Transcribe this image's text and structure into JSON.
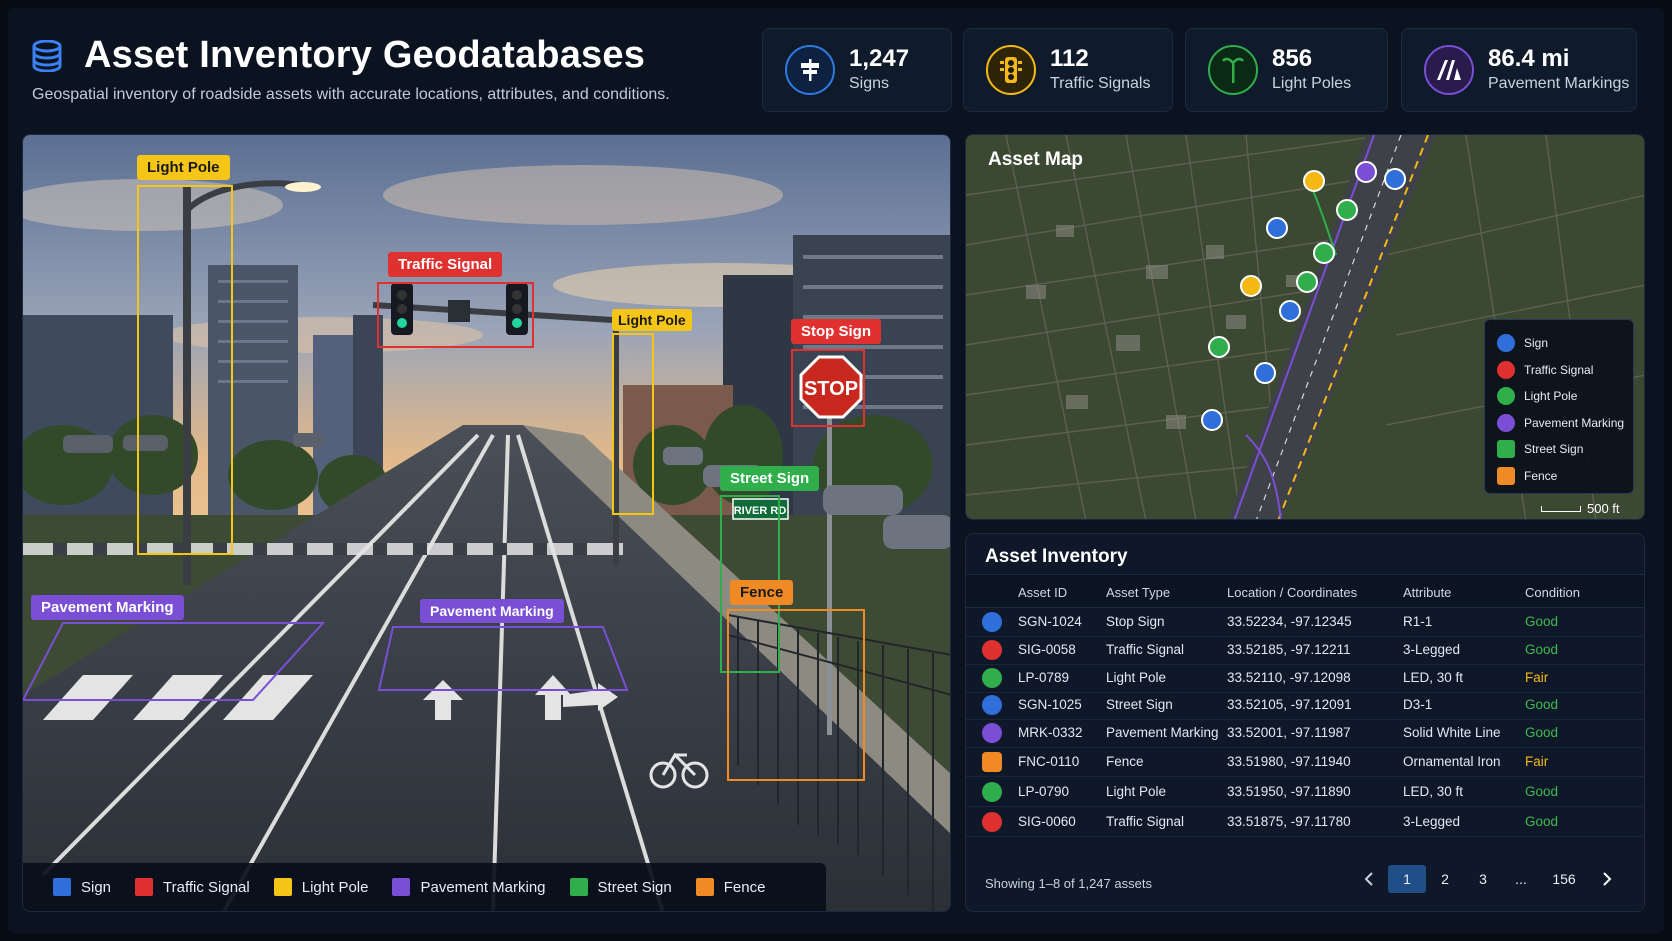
{
  "header": {
    "title": "Asset Inventory Geodatabases",
    "subtitle": "Geospatial inventory of roadside assets with accurate locations, attributes, and conditions."
  },
  "stats": [
    {
      "value": "1,247",
      "label": "Signs",
      "icon": "sign-icon",
      "color": "#2f7ae5"
    },
    {
      "value": "112",
      "label": "Traffic Signals",
      "icon": "traffic-light-icon",
      "color": "#f5b915"
    },
    {
      "value": "856",
      "label": "Light Poles",
      "icon": "light-pole-icon",
      "color": "#2fae4b"
    },
    {
      "value": "86.4 mi",
      "label": "Pavement Markings",
      "icon": "pavement-marking-icon",
      "color": "#7a4fd6"
    }
  ],
  "photo": {
    "tags": {
      "light_pole_1": "Light Pole",
      "traffic_signal": "Traffic Signal",
      "light_pole_2": "Light Pole",
      "stop_sign": "Stop Sign",
      "street_sign": "Street Sign",
      "fence": "Fence",
      "pavement_marking_1": "Pavement Marking",
      "pavement_marking_2": "Pavement Marking"
    },
    "stop_text": "STOP",
    "street_sign_text": "RIVER RD",
    "legend": [
      {
        "label": "Sign",
        "color": "#2f6fdc"
      },
      {
        "label": "Traffic Signal",
        "color": "#e03131"
      },
      {
        "label": "Light Pole",
        "color": "#f5c518"
      },
      {
        "label": "Pavement Marking",
        "color": "#7a4fd6"
      },
      {
        "label": "Street Sign",
        "color": "#2fae4b"
      },
      {
        "label": "Fence",
        "color": "#f08a24"
      }
    ]
  },
  "map": {
    "title": "Asset Map",
    "legend": [
      {
        "label": "Sign",
        "color": "#2f6fdc",
        "icon": "sign-icon"
      },
      {
        "label": "Traffic Signal",
        "color": "#e03131",
        "icon": "traffic-light-icon"
      },
      {
        "label": "Light Pole",
        "color": "#2fae4b",
        "icon": "light-pole-icon"
      },
      {
        "label": "Pavement Marking",
        "color": "#7a4fd6",
        "icon": "pavement-marking-icon"
      },
      {
        "label": "Street Sign",
        "color": "#2fae4b",
        "icon": "street-sign-icon"
      },
      {
        "label": "Fence",
        "color": "#f08a24",
        "icon": "fence-icon"
      }
    ],
    "scale": "500 ft"
  },
  "inventory": {
    "title": "Asset Inventory",
    "columns": [
      "Asset ID",
      "Asset Type",
      "Location / Coordinates",
      "Attribute",
      "Condition"
    ],
    "rows": [
      {
        "id": "SGN-1024",
        "type": "Stop Sign",
        "loc": "33.52234, -97.12345",
        "attr": "R1-1",
        "cond": "Good",
        "kind": "sign"
      },
      {
        "id": "SIG-0058",
        "type": "Traffic Signal",
        "loc": "33.52185, -97.12211",
        "attr": "3-Legged",
        "cond": "Good",
        "kind": "signal"
      },
      {
        "id": "LP-0789",
        "type": "Light Pole",
        "loc": "33.52110, -97.12098",
        "attr": "LED, 30 ft",
        "cond": "Fair",
        "kind": "pole"
      },
      {
        "id": "SGN-1025",
        "type": "Street Sign",
        "loc": "33.52105, -97.12091",
        "attr": "D3-1",
        "cond": "Good",
        "kind": "sign"
      },
      {
        "id": "MRK-0332",
        "type": "Pavement Marking",
        "loc": "33.52001, -97.11987",
        "attr": "Solid White Line",
        "cond": "Good",
        "kind": "marking"
      },
      {
        "id": "FNC-0110",
        "type": "Fence",
        "loc": "33.51980, -97.11940",
        "attr": "Ornamental Iron",
        "cond": "Fair",
        "kind": "fence"
      },
      {
        "id": "LP-0790",
        "type": "Light Pole",
        "loc": "33.51950, -97.11890",
        "attr": "LED, 30 ft",
        "cond": "Good",
        "kind": "pole"
      },
      {
        "id": "SIG-0060",
        "type": "Traffic Signal",
        "loc": "33.51875, -97.11780",
        "attr": "3-Legged",
        "cond": "Good",
        "kind": "signal"
      }
    ],
    "condition_colors": {
      "Good": "#3fb950",
      "Fair": "#f5b915"
    },
    "showing": "Showing 1–8 of 1,247 assets",
    "pages": [
      "1",
      "2",
      "3",
      "...",
      "156"
    ],
    "active_page": "1"
  }
}
